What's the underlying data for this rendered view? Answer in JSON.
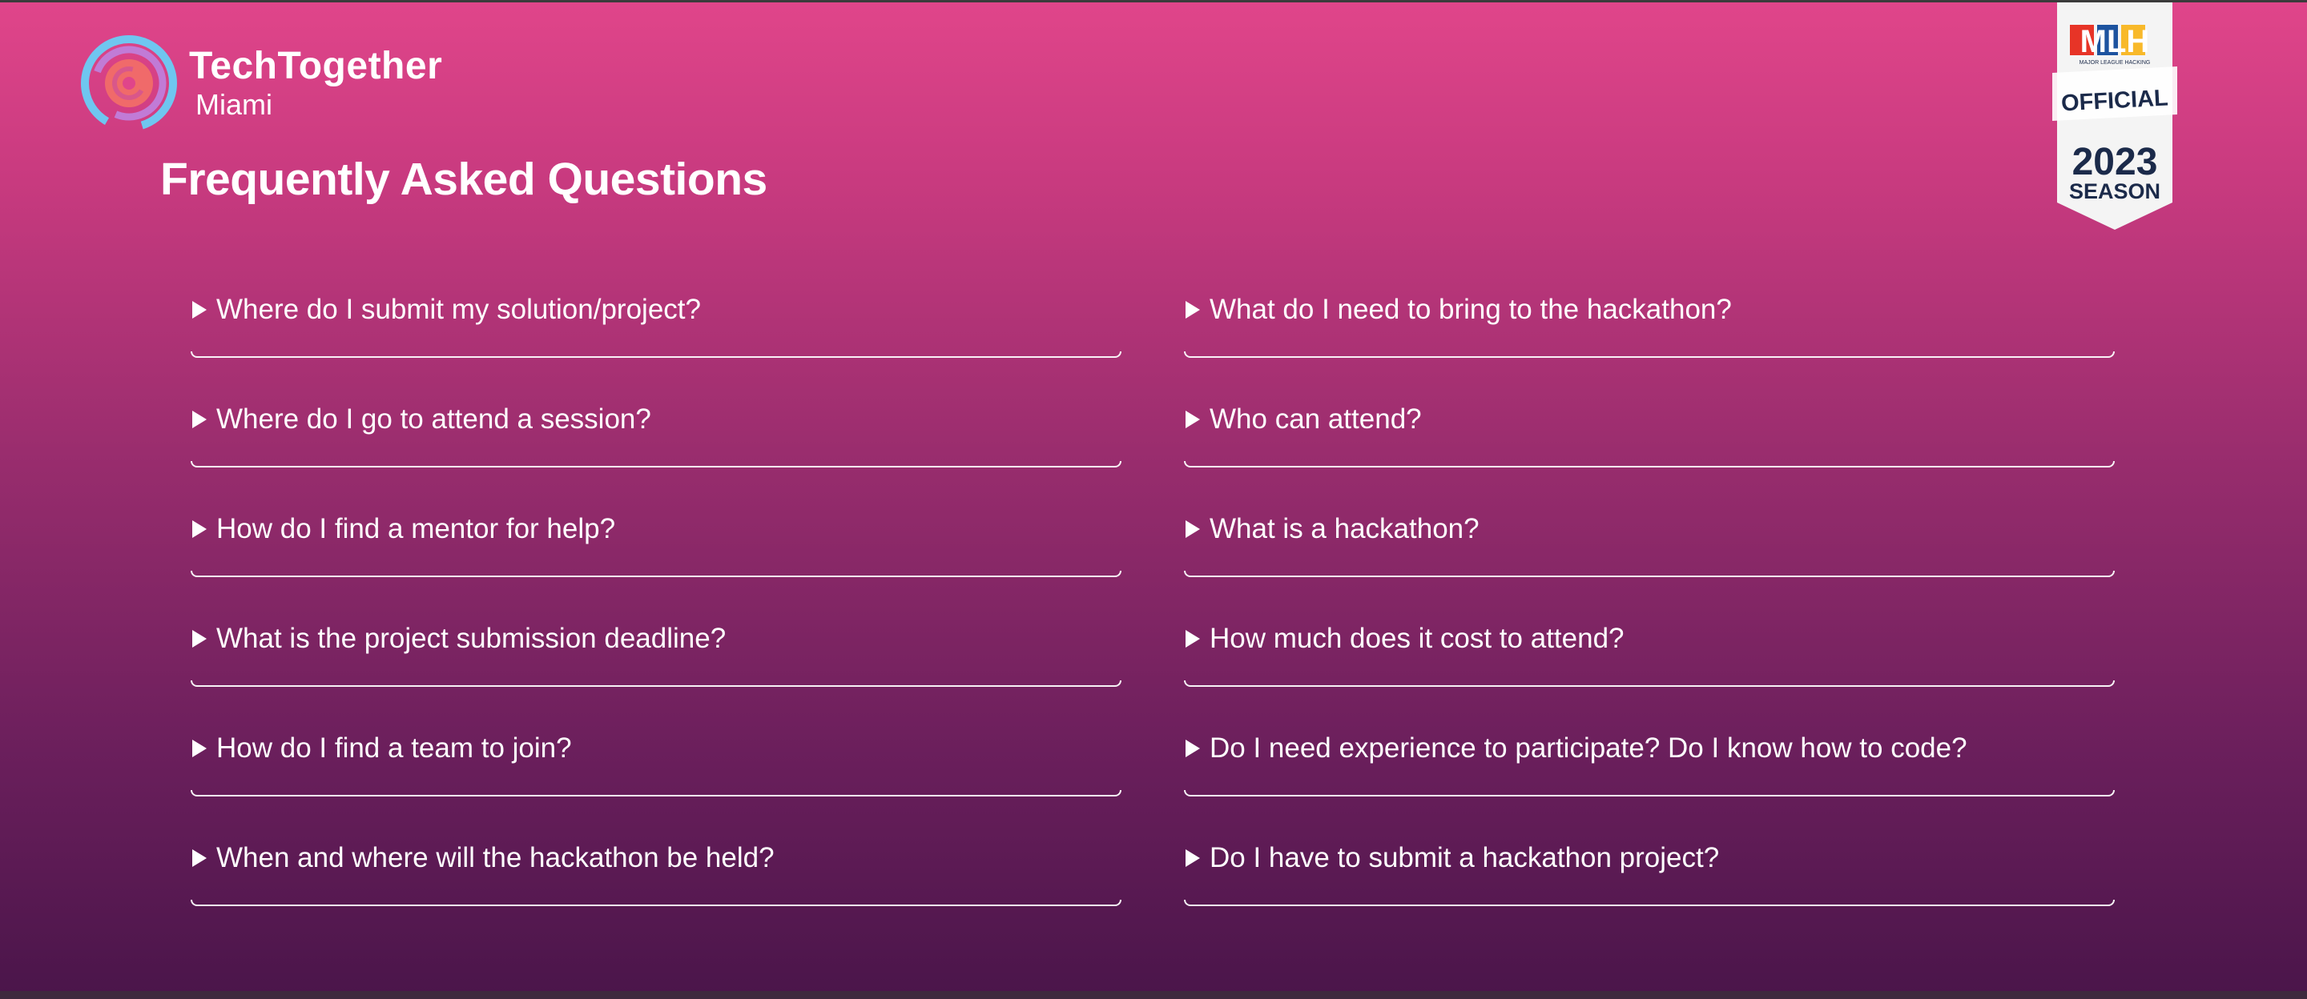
{
  "brand": {
    "name": "TechTogether",
    "city": "Miami"
  },
  "page": {
    "title": "Frequently Asked Questions"
  },
  "badge": {
    "logo": "MLH",
    "subtitle": "MAJOR LEAGUE HACKING",
    "official": "OFFICIAL",
    "year": "2023",
    "season": "SEASON"
  },
  "faq": {
    "left": [
      {
        "question": "Where do I submit my solution/project?"
      },
      {
        "question": "Where do I go to attend a session?"
      },
      {
        "question": "How do I find a mentor for help?"
      },
      {
        "question": "What is the project submission deadline?"
      },
      {
        "question": "How do I find a team to join?"
      },
      {
        "question": "When and where will the hackathon be held?"
      }
    ],
    "right": [
      {
        "question": "What do I need to bring to the hackathon?"
      },
      {
        "question": "Who can attend?"
      },
      {
        "question": "What is a hackathon?"
      },
      {
        "question": "How much does it cost to attend?"
      },
      {
        "question": "Do I need experience to participate? Do I know how to code?"
      },
      {
        "question": "Do I have to submit a hackathon project?"
      }
    ]
  },
  "icons": {
    "disclosure": "triangle-right-icon",
    "logo": "techtogether-logo-icon"
  },
  "colors": {
    "gradient_top": "#e0458a",
    "gradient_bottom": "#4a154a",
    "text": "#ffffff",
    "mlh_red": "#e73427",
    "mlh_blue": "#1d539f",
    "mlh_yellow": "#f8b92a",
    "badge_navy": "#1b2a4a"
  }
}
